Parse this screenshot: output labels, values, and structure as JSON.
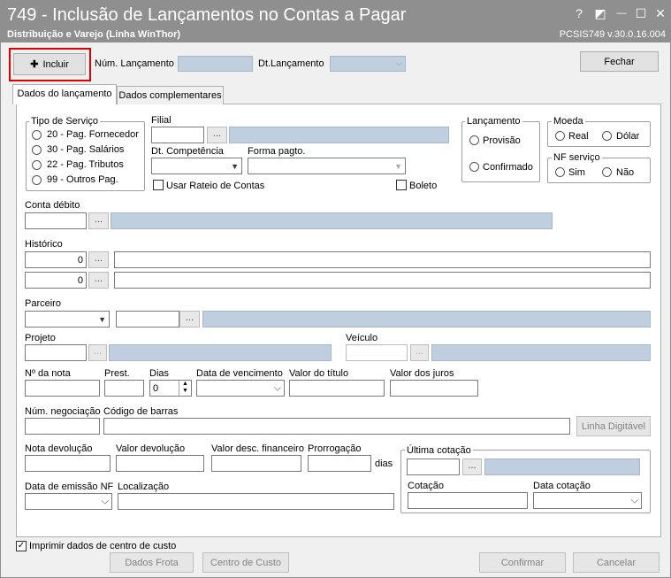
{
  "window": {
    "title": "749 - Inclusão de Lançamentos no Contas a Pagar",
    "subtitle": "Distribuição e Varejo (Linha WinThor)",
    "version": "PCSIS749  v.30.0.16.004",
    "help": "?",
    "restore": "◩",
    "minimize": "—",
    "maximize": "☐",
    "close": "✕"
  },
  "toolbar": {
    "incluir": "Incluir",
    "incluir_icon": "plus-icon",
    "num_lancamento": "Núm. Lançamento",
    "dt_lancamento": "Dt.Lançamento",
    "fechar": "Fechar"
  },
  "tabs": [
    "Dados do lançamento",
    "Dados complementares"
  ],
  "tipo_servico": {
    "label": "Tipo de Serviço",
    "options": [
      "20 - Pag. Fornecedor",
      "30 - Pag. Salários",
      "22 - Pag. Tributos",
      "99 - Outros Pag."
    ]
  },
  "filial": {
    "label": "Filial",
    "ellipsis": "..."
  },
  "dt_competencia": "Dt. Competência",
  "forma_pagto": "Forma pagto.",
  "usar_rateio": "Usar Rateio de Contas",
  "boleto": "Boleto",
  "lancamento": {
    "label": "Lançamento",
    "options": [
      "Provisão",
      "Confirmado"
    ]
  },
  "moeda": {
    "label": "Moeda",
    "options": [
      "Real",
      "Dólar"
    ]
  },
  "nf_servico": {
    "label": "NF serviço",
    "options": [
      "Sim",
      "Não"
    ]
  },
  "conta_debito": "Conta débito",
  "historico": {
    "label": "Histórico",
    "values": [
      "0",
      "0"
    ]
  },
  "parceiro": "Parceiro",
  "projeto": "Projeto",
  "veiculo": "Veículo",
  "row_nota": {
    "nota": "Nº da nota",
    "prest": "Prest.",
    "dias": "Dias",
    "dias_value": "0",
    "vencimento": "Data de vencimento",
    "valor_titulo": "Valor do título",
    "valor_juros": "Valor dos juros"
  },
  "row_neg": {
    "num_negociacao": "Núm. negociação",
    "codigo_barras": "Código de barras",
    "linha_digitavel": "Linha Digitável"
  },
  "row_dev": {
    "nota_devolucao": "Nota devolução",
    "valor_devolucao": "Valor devolução",
    "valor_desc": "Valor desc. financeiro",
    "prorrogacao": "Prorrogação",
    "dias": "dias"
  },
  "ultima_cotacao": {
    "label": "Última cotação",
    "cotacao": "Cotação",
    "data_cotacao": "Data cotação"
  },
  "row_emissao": {
    "data_emissao": "Data de emissão NF",
    "localizacao": "Localização"
  },
  "footer": {
    "imprimir": "Imprimir dados de centro de custo",
    "dados_frota": "Dados Frota",
    "centro_custo": "Centro de Custo",
    "confirmar": "Confirmar",
    "cancelar": "Cancelar"
  },
  "colors": {
    "titlebar": "#8f8f8f",
    "readonly_field": "#bfcfe0",
    "highlight": "#e00000"
  }
}
